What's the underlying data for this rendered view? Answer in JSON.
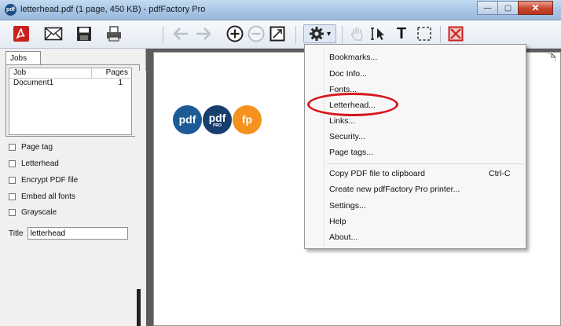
{
  "window": {
    "title": "letterhead.pdf (1 page, 450 KB) - pdfFactory Pro",
    "app_icon_text": "pdf",
    "minimize_glyph": "—",
    "maximize_glyph": "▢",
    "close_glyph": "✕"
  },
  "toolbar": {
    "icons": [
      "acrobat-icon",
      "mail-icon",
      "save-icon",
      "print-icon",
      "back-arrow-icon",
      "forward-arrow-icon",
      "zoom-in-icon",
      "zoom-out-icon",
      "fit-page-icon",
      "gear-icon",
      "hand-icon",
      "select-text-icon",
      "text-tool-icon",
      "selection-rect-icon",
      "delete-page-icon"
    ],
    "gear_dropdown_arrow": "▾",
    "text_tool_label": "T"
  },
  "jobs_panel": {
    "tab_label": "Jobs",
    "columns": [
      "Job",
      "Pages"
    ],
    "rows": [
      {
        "job": "Document1",
        "pages": "1"
      }
    ]
  },
  "options": [
    {
      "label": "Page tag",
      "checked": false
    },
    {
      "label": "Letterhead",
      "checked": false
    },
    {
      "label": "Encrypt PDF file",
      "checked": false
    },
    {
      "label": "Embed all fonts",
      "checked": false
    },
    {
      "label": "Grayscale",
      "checked": false
    }
  ],
  "title_field": {
    "label": "Title",
    "value": "letterhead"
  },
  "preview": {
    "logos": [
      "pdf",
      "pdf",
      "fp"
    ],
    "logo_pro_text": "PRO"
  },
  "menu": {
    "items": [
      {
        "label": "Bookmarks..."
      },
      {
        "label": "Doc Info..."
      },
      {
        "label": "Fonts..."
      },
      {
        "label": "Letterhead..."
      },
      {
        "label": "Links..."
      },
      {
        "label": "Security..."
      },
      {
        "label": "Page tags..."
      },
      {
        "label": "Copy PDF file to clipboard",
        "shortcut": "Ctrl-C"
      },
      {
        "label": "Create new pdfFactory Pro printer..."
      },
      {
        "label": "Settings..."
      },
      {
        "label": "Help"
      },
      {
        "label": "About..."
      }
    ],
    "highlighted_item": "Letterhead...",
    "highlight_color": "#d7161b"
  }
}
